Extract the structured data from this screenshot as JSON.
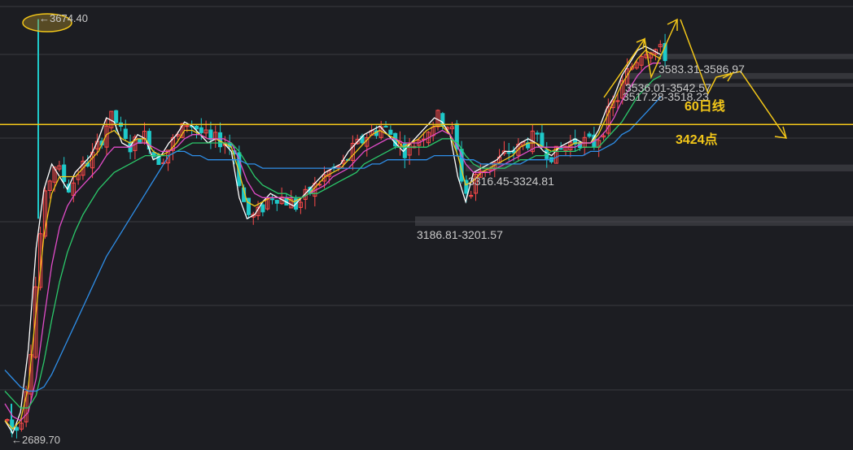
{
  "chart_data": {
    "type": "candlestick",
    "title": "",
    "ylim": [
      2650,
      3720
    ],
    "grid": true,
    "x_count": 140,
    "price_labels": {
      "high": "←3674.40",
      "low": "←2689.70"
    },
    "price_extremes": {
      "high": 3674.4,
      "low": 2689.7
    },
    "gap_zones": [
      {
        "label": "3583.31-3586.97",
        "low": 3583.31,
        "high": 3586.97
      },
      {
        "label": "3536.01-3542.57",
        "low": 3536.01,
        "high": 3542.57
      },
      {
        "label": "3517.28-3518.23",
        "low": 3517.28,
        "high": 3518.23
      },
      {
        "label": "3316.45-3324.81",
        "low": 3316.45,
        "high": 3324.81
      },
      {
        "label": "3186.81-3201.57",
        "low": 3186.81,
        "high": 3201.57
      }
    ],
    "annotations": [
      {
        "text": "60日线"
      },
      {
        "text": "3424点",
        "value": 3424
      }
    ],
    "colors": {
      "up": "#ff4a4a",
      "down": "#1fc9c9",
      "annotation": "#f2c619",
      "ma_white": "#ffffff",
      "ma_yellow": "#f2c619",
      "ma_pink": "#e04cc8",
      "ma_green": "#2bc86a",
      "ma_blue": "#2e8ee8",
      "label": "#c9c9c9",
      "grid": "#3a3b40"
    },
    "ma_series": [
      {
        "color": "white",
        "values": [
          2720,
          2690,
          2740,
          2890,
          3130,
          3270,
          3330,
          3300,
          3270,
          3310,
          3330,
          3350,
          3390,
          3440,
          3430,
          3380,
          3370,
          3400,
          3390,
          3340,
          3350,
          3380,
          3400,
          3430,
          3420,
          3400,
          3380,
          3390,
          3380,
          3360,
          3250,
          3200,
          3210,
          3240,
          3260,
          3250,
          3240,
          3230,
          3250,
          3270,
          3290,
          3310,
          3320,
          3330,
          3360,
          3380,
          3400,
          3410,
          3420,
          3400,
          3380,
          3360,
          3380,
          3400,
          3420,
          3440,
          3430,
          3400,
          3300,
          3240,
          3310,
          3320,
          3330,
          3340,
          3360,
          3360,
          3380,
          3390,
          3380,
          3360,
          3350,
          3370,
          3380,
          3390,
          3380,
          3380,
          3410,
          3460,
          3490,
          3540,
          3570,
          3600,
          3610,
          3600,
          3590
        ]
      },
      {
        "color": "yellow",
        "values": [
          2720,
          2700,
          2720,
          2800,
          2980,
          3160,
          3260,
          3300,
          3300,
          3300,
          3320,
          3340,
          3360,
          3400,
          3410,
          3390,
          3380,
          3390,
          3390,
          3360,
          3350,
          3360,
          3380,
          3410,
          3410,
          3400,
          3390,
          3390,
          3380,
          3370,
          3310,
          3240,
          3230,
          3240,
          3250,
          3250,
          3250,
          3240,
          3250,
          3260,
          3280,
          3300,
          3310,
          3320,
          3340,
          3360,
          3380,
          3400,
          3410,
          3400,
          3390,
          3370,
          3380,
          3390,
          3410,
          3420,
          3420,
          3400,
          3350,
          3280,
          3290,
          3310,
          3320,
          3330,
          3340,
          3350,
          3370,
          3380,
          3380,
          3370,
          3360,
          3370,
          3370,
          3380,
          3380,
          3380,
          3400,
          3440,
          3480,
          3520,
          3550,
          3580,
          3600,
          3590,
          3580
        ]
      },
      {
        "color": "pink",
        "values": [
          2760,
          2730,
          2720,
          2740,
          2820,
          2960,
          3090,
          3180,
          3230,
          3260,
          3280,
          3300,
          3320,
          3350,
          3370,
          3370,
          3370,
          3380,
          3380,
          3370,
          3360,
          3360,
          3370,
          3390,
          3400,
          3400,
          3390,
          3390,
          3390,
          3380,
          3340,
          3290,
          3260,
          3250,
          3250,
          3250,
          3250,
          3250,
          3250,
          3260,
          3270,
          3280,
          3300,
          3310,
          3320,
          3340,
          3360,
          3370,
          3380,
          3390,
          3390,
          3380,
          3380,
          3380,
          3390,
          3400,
          3410,
          3400,
          3370,
          3330,
          3310,
          3310,
          3310,
          3320,
          3330,
          3340,
          3350,
          3360,
          3370,
          3370,
          3370,
          3370,
          3370,
          3370,
          3380,
          3380,
          3390,
          3410,
          3440,
          3480,
          3510,
          3540,
          3560,
          3570,
          3570
        ]
      },
      {
        "color": "green",
        "values": [
          2790,
          2770,
          2750,
          2750,
          2780,
          2860,
          2960,
          3050,
          3120,
          3170,
          3210,
          3240,
          3270,
          3290,
          3310,
          3320,
          3330,
          3340,
          3350,
          3350,
          3350,
          3350,
          3360,
          3370,
          3380,
          3380,
          3380,
          3380,
          3380,
          3380,
          3360,
          3330,
          3300,
          3280,
          3270,
          3260,
          3260,
          3250,
          3250,
          3260,
          3260,
          3270,
          3280,
          3290,
          3300,
          3310,
          3330,
          3340,
          3350,
          3360,
          3370,
          3370,
          3370,
          3370,
          3370,
          3380,
          3390,
          3390,
          3380,
          3350,
          3330,
          3320,
          3320,
          3320,
          3320,
          3330,
          3340,
          3340,
          3350,
          3350,
          3360,
          3360,
          3360,
          3360,
          3370,
          3370,
          3370,
          3390,
          3410,
          3430,
          3460,
          3490,
          3510,
          3530,
          3540
        ]
      },
      {
        "color": "blue",
        "values": [
          2840,
          2820,
          2800,
          2790,
          2790,
          2800,
          2830,
          2870,
          2910,
          2950,
          2990,
          3030,
          3070,
          3110,
          3140,
          3170,
          3200,
          3230,
          3260,
          3290,
          3320,
          3350,
          3360,
          3360,
          3350,
          3350,
          3340,
          3340,
          3340,
          3340,
          3340,
          3330,
          3330,
          3320,
          3320,
          3320,
          3320,
          3320,
          3320,
          3320,
          3320,
          3320,
          3320,
          3320,
          3320,
          3320,
          3320,
          3330,
          3330,
          3340,
          3340,
          3340,
          3340,
          3340,
          3340,
          3350,
          3350,
          3350,
          3350,
          3340,
          3340,
          3330,
          3330,
          3330,
          3330,
          3330,
          3330,
          3340,
          3340,
          3340,
          3340,
          3350,
          3350,
          3350,
          3350,
          3360,
          3360,
          3370,
          3380,
          3400,
          3410,
          3430,
          3450,
          3470,
          3490
        ]
      }
    ]
  }
}
